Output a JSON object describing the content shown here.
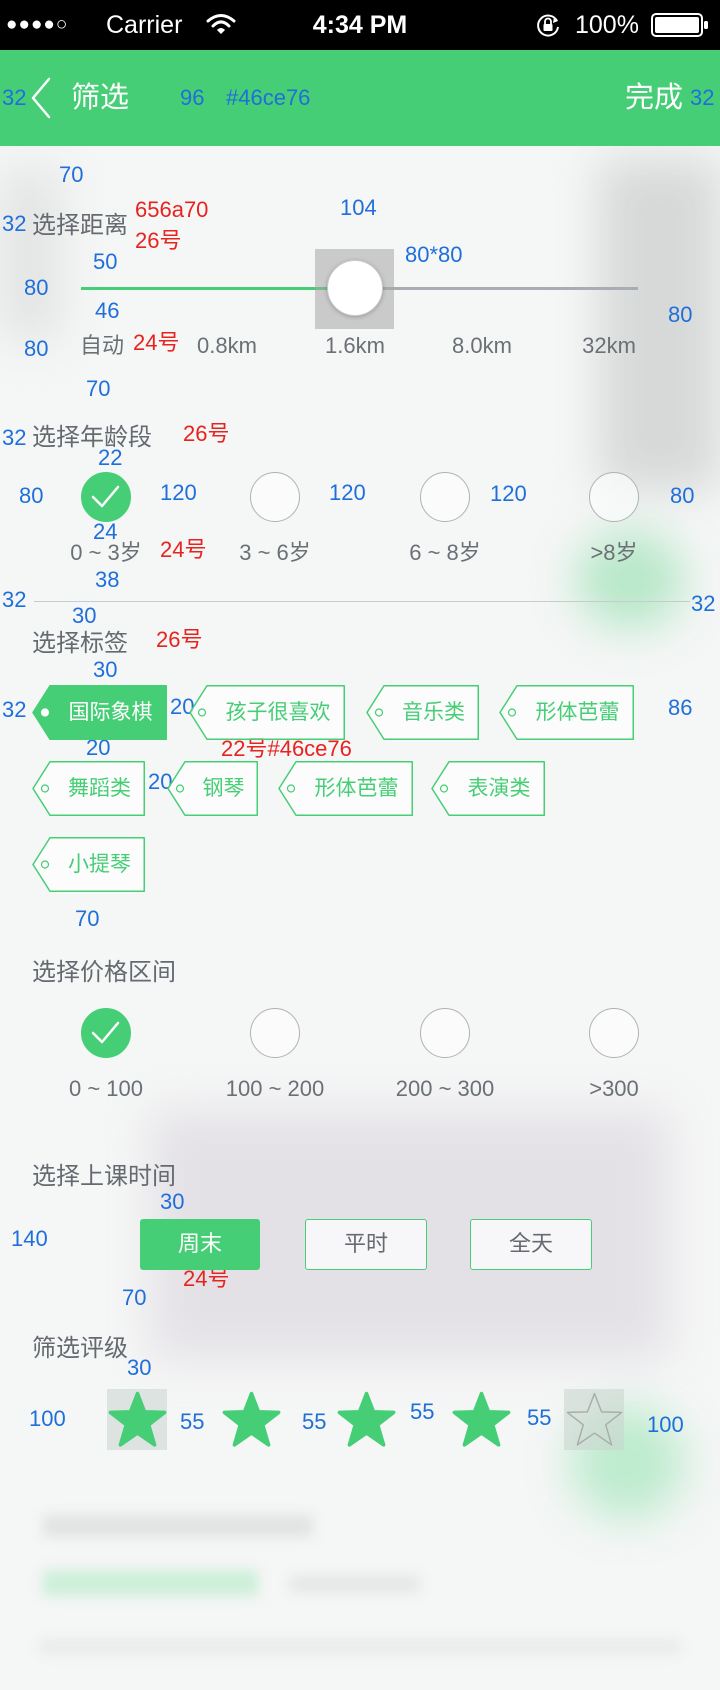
{
  "status_bar": {
    "signal": "●●●●○",
    "carrier": "Carrier",
    "time": "4:34 PM",
    "battery": "100%"
  },
  "nav": {
    "back_icon": "chevron-left-icon",
    "title": "筛选",
    "done_label": "完成"
  },
  "colors": {
    "accent": "#46ce76",
    "label_text": "#656a70",
    "annotation_blue": "#1f6fdb",
    "annotation_red": "#e8231f"
  },
  "distance": {
    "label": "选择距离",
    "options": [
      "自动",
      "0.8km",
      "1.6km",
      "8.0km",
      "32km"
    ],
    "selected_index": 2
  },
  "age": {
    "label": "选择年龄段",
    "options": [
      "0 ~ 3岁",
      "3 ~ 6岁",
      "6 ~ 8岁",
      ">8岁"
    ],
    "selected_index": 0
  },
  "tags": {
    "label": "选择标签",
    "items": [
      {
        "label": "国际象棋",
        "selected": true
      },
      {
        "label": "孩子很喜欢",
        "selected": false
      },
      {
        "label": "音乐类",
        "selected": false
      },
      {
        "label": "形体芭蕾",
        "selected": false
      },
      {
        "label": "舞蹈类",
        "selected": false
      },
      {
        "label": "钢琴",
        "selected": false
      },
      {
        "label": "形体芭蕾",
        "selected": false
      },
      {
        "label": "表演类",
        "selected": false
      },
      {
        "label": "小提琴",
        "selected": false
      }
    ]
  },
  "price": {
    "label": "选择价格区间",
    "options": [
      "0 ~ 100",
      "100 ~ 200",
      "200 ~ 300",
      ">300"
    ],
    "selected_index": 0
  },
  "class_time": {
    "label": "选择上课时间",
    "options": [
      "周末",
      "平时",
      "全天"
    ],
    "selected_index": 0
  },
  "rating": {
    "label": "筛选评级",
    "value": 4,
    "max": 5,
    "icon": "star-icon"
  },
  "annotations": [
    "32",
    "96",
    "#46ce76",
    "32",
    "70",
    "32",
    "656a70",
    "26号",
    "104",
    "50",
    "80*80",
    "80",
    "46",
    "80",
    "80",
    "24号",
    "70",
    "32",
    "26号",
    "22",
    "80",
    "120",
    "120",
    "120",
    "80",
    "24",
    "24号",
    "38",
    "32",
    "32",
    "30",
    "26号",
    "30",
    "32",
    "20",
    "86",
    "20",
    "22号#46ce76",
    "20",
    "70",
    "30",
    "140",
    "70",
    "24号",
    "30",
    "100",
    "55",
    "55",
    "55",
    "55",
    "100"
  ]
}
